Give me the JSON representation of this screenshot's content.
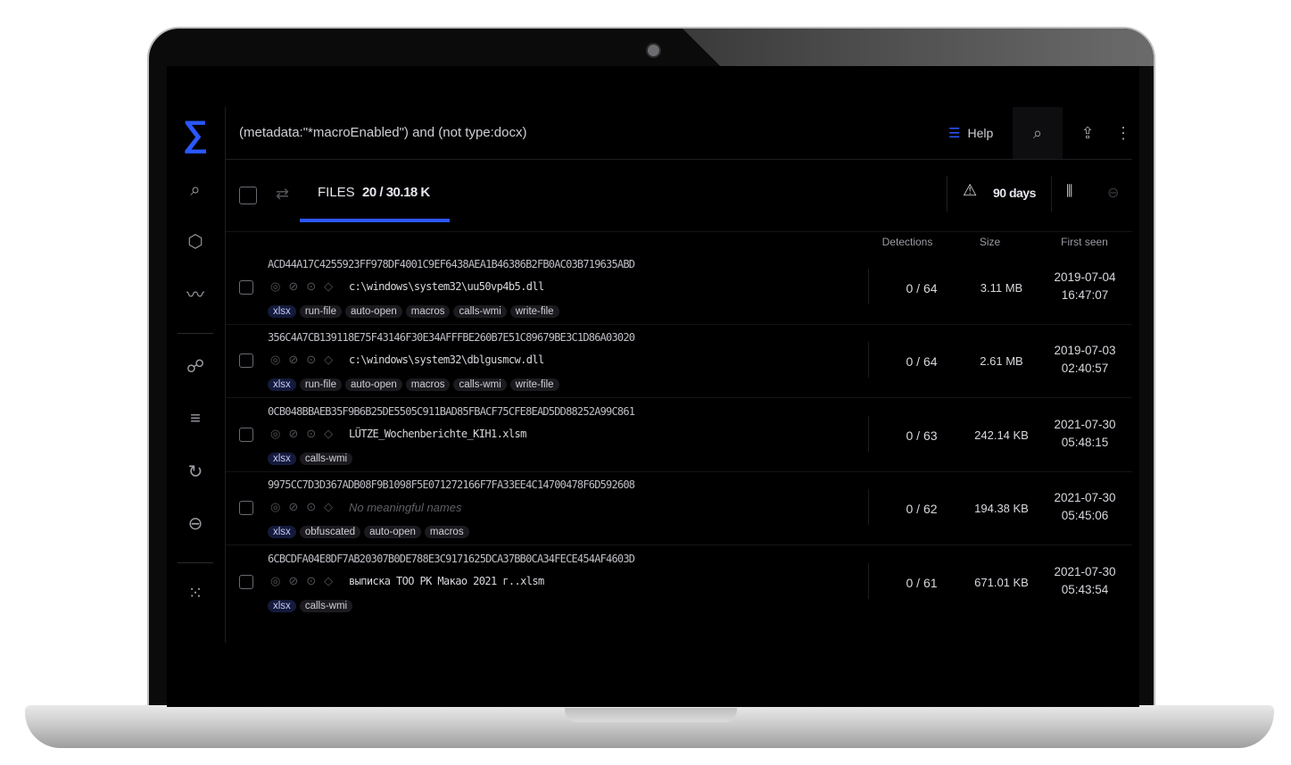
{
  "search": {
    "query": "(metadata:\"*macroEnabled\") and (not type:docx)",
    "help_label": "Help"
  },
  "toolbar": {
    "files_label": "FILES",
    "files_count": "20 / 30.18 K",
    "period_label": "90 days"
  },
  "columns": {
    "detections": "Detections",
    "size": "Size",
    "first_seen": "First seen"
  },
  "rows": [
    {
      "hash": "ACD44A17C4255923FF978DF4001C9EF6438AEA1B46386B2FB0AC03B719635ABD",
      "name": "c:\\windows\\system32\\uu50vp4b5.dll",
      "tags": [
        "xlsx",
        "run-file",
        "auto-open",
        "macros",
        "calls-wmi",
        "write-file"
      ],
      "detections": "0 / 64",
      "size": "3.11 MB",
      "date": "2019-07-04",
      "time": "16:47:07"
    },
    {
      "hash": "356C4A7CB139118E75F43146F30E34AFFFBE260B7E51C89679BE3C1D86A03020",
      "name": "c:\\windows\\system32\\dblgusmcw.dll",
      "tags": [
        "xlsx",
        "run-file",
        "auto-open",
        "macros",
        "calls-wmi",
        "write-file"
      ],
      "detections": "0 / 64",
      "size": "2.61 MB",
      "date": "2019-07-03",
      "time": "02:40:57"
    },
    {
      "hash": "0CB048BBAEB35F9B6B25DE5505C911BAD85FBACF75CFE8EAD5DD88252A99C861",
      "name": "LÜTZE_Wochenberichte_KIH1.xlsm",
      "tags": [
        "xlsx",
        "calls-wmi"
      ],
      "detections": "0 / 63",
      "size": "242.14 KB",
      "date": "2021-07-30",
      "time": "05:48:15"
    },
    {
      "hash": "9975CC7D3D367ADB08F9B1098F5E071272166F7FA33EE4C14700478F6D592608",
      "name": "No meaningful names",
      "tags": [
        "xlsx",
        "obfuscated",
        "auto-open",
        "macros"
      ],
      "detections": "0 / 62",
      "size": "194.38 KB",
      "date": "2021-07-30",
      "time": "05:45:06"
    },
    {
      "hash": "6CBCDFA04E8DF7AB20307B0DE788E3C9171625DCA37BB0CA34FECE454AF4603D",
      "name": "выписка ТОО РК Макао 2021 г..xlsm",
      "tags": [
        "xlsx",
        "calls-wmi"
      ],
      "detections": "0 / 61",
      "size": "671.01 KB",
      "date": "2021-07-30",
      "time": "05:43:54"
    }
  ],
  "icons": {
    "logo": "sigma-logo",
    "accent": "#2a57ff"
  }
}
